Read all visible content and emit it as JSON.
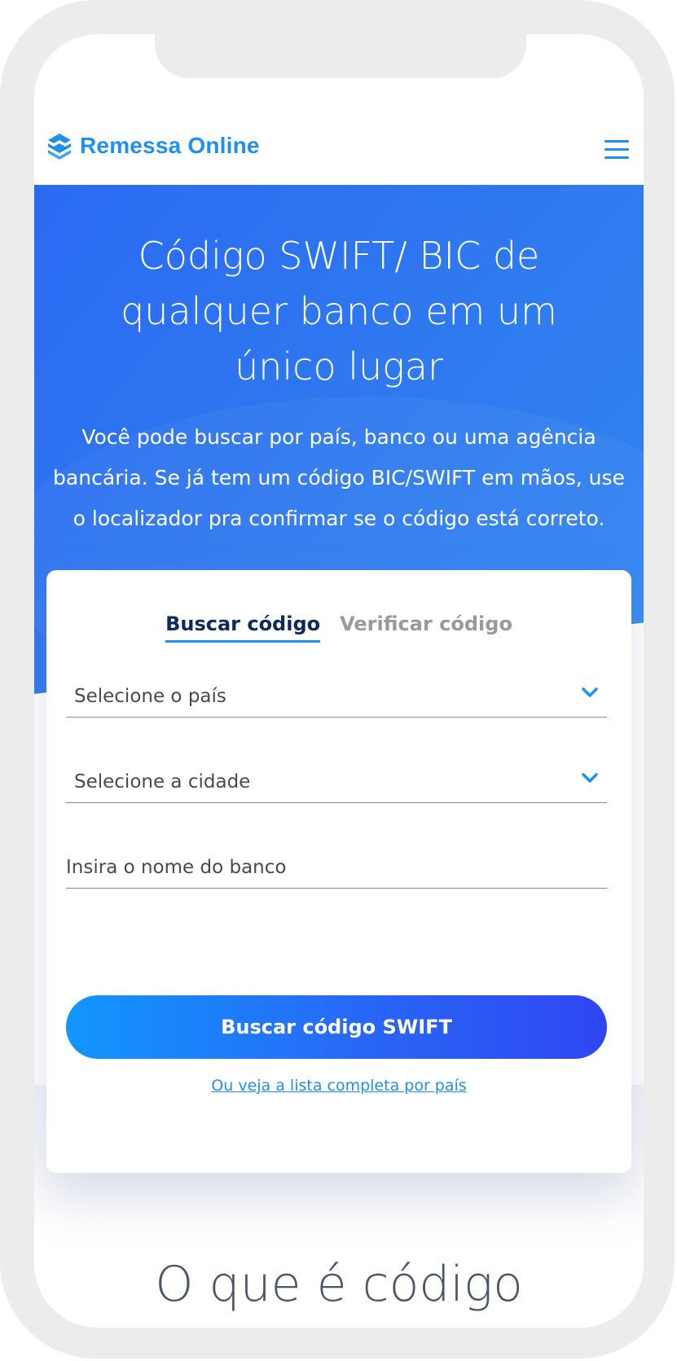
{
  "header": {
    "logo_text": "Remessa Online",
    "menu_icon": "hamburger-menu-icon"
  },
  "hero": {
    "title": "Código SWIFT/ BIC de qualquer banco em um único lugar",
    "subtitle": "Você pode buscar por país, banco ou uma agência bancária. Se já tem um código BIC/SWIFT em mãos, use o localizador pra confirmar se o código está correto."
  },
  "form": {
    "tabs": [
      {
        "label": "Buscar código",
        "active": true
      },
      {
        "label": "Verificar código",
        "active": false
      }
    ],
    "country_select": "Selecione o país",
    "city_select": "Selecione a cidade",
    "bank_input_placeholder": "Insira o nome do banco",
    "submit_label": "Buscar código SWIFT",
    "list_link": "Ou veja a lista completa por país"
  },
  "next_section": {
    "title": "O que é código"
  },
  "colors": {
    "brand": "#1f8ff0",
    "hero_bg": "#2f79f0",
    "tab_active": "#0d2a5c",
    "tab_inactive": "#9a9a9a"
  }
}
